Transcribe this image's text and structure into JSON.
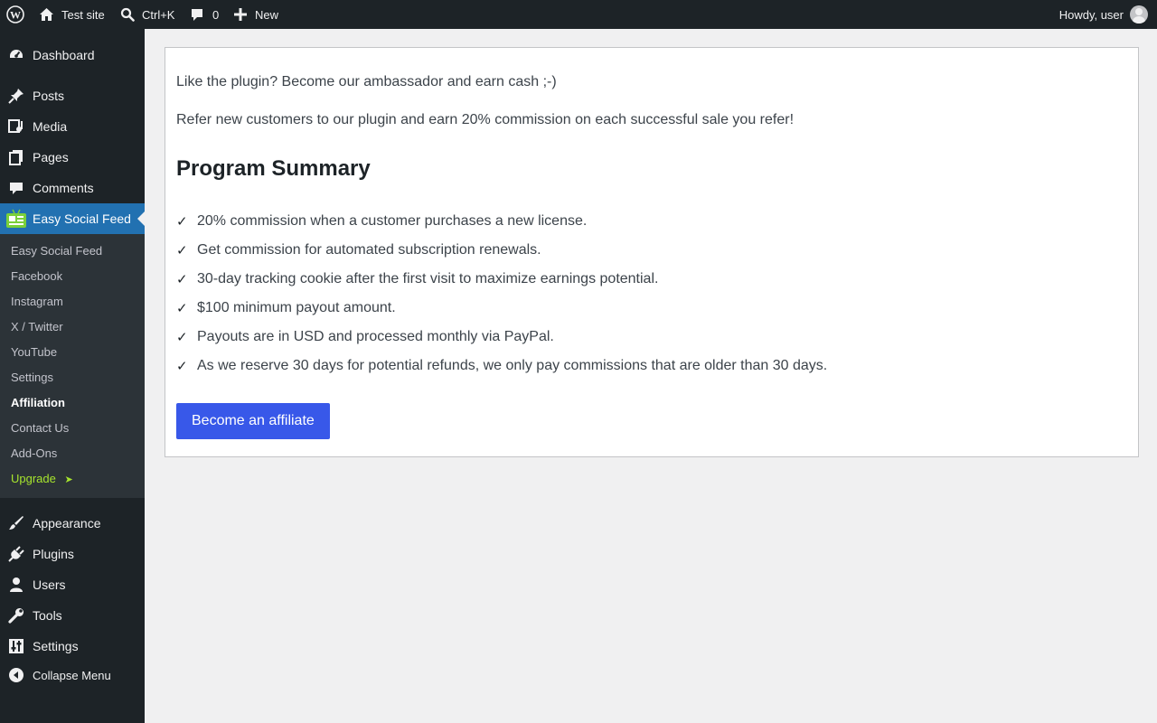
{
  "admin_bar": {
    "site_name": "Test site",
    "search_shortcut": "Ctrl+K",
    "comments_count": "0",
    "new_label": "New",
    "greeting": "Howdy, user"
  },
  "sidebar": {
    "items": [
      {
        "label": "Dashboard",
        "icon": "dashboard-icon"
      },
      {
        "label": "Posts",
        "icon": "pushpin-icon"
      },
      {
        "label": "Media",
        "icon": "media-icon"
      },
      {
        "label": "Pages",
        "icon": "pages-icon"
      },
      {
        "label": "Comments",
        "icon": "comment-icon"
      },
      {
        "label": "Easy Social Feed",
        "icon": "easy-social-feed-icon"
      },
      {
        "label": "Appearance",
        "icon": "paintbrush-icon"
      },
      {
        "label": "Plugins",
        "icon": "plug-icon"
      },
      {
        "label": "Users",
        "icon": "user-icon"
      },
      {
        "label": "Tools",
        "icon": "wrench-icon"
      },
      {
        "label": "Settings",
        "icon": "sliders-icon"
      }
    ],
    "submenu": [
      "Easy Social Feed",
      "Facebook",
      "Instagram",
      "X / Twitter",
      "YouTube",
      "Settings",
      "Affiliation",
      "Contact Us",
      "Add-Ons",
      "Upgrade"
    ],
    "upgrade_arrow": "➤",
    "collapse_label": "Collapse Menu"
  },
  "content": {
    "intro": "Like the plugin? Become our ambassador and earn cash ;-)",
    "refer": "Refer new customers to our plugin and earn 20% commission on each successful sale you refer!",
    "heading": "Program Summary",
    "check_mark": "✓",
    "benefits": [
      "20% commission when a customer purchases a new license.",
      "Get commission for automated subscription renewals.",
      "30-day tracking cookie after the first visit to maximize earnings potential.",
      "$100 minimum payout amount.",
      "Payouts are in USD and processed monthly via PayPal.",
      "As we reserve 30 days for potential refunds, we only pay commissions that are older than 30 days."
    ],
    "button_label": "Become an affiliate"
  },
  "colors": {
    "admin_bar_bg": "#1d2327",
    "sidebar_bg": "#1d2327",
    "submenu_bg": "#2c3338",
    "current_menu": "#2271b1",
    "button": "#3858e9",
    "upgrade": "#a7e52d",
    "page_bg": "#f0f0f1"
  }
}
